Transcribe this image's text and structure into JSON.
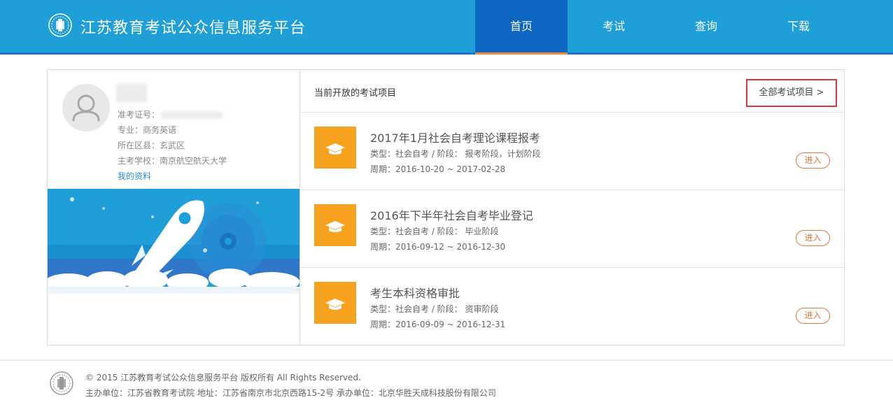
{
  "header": {
    "site_title": "江苏教育考试公众信息服务平台",
    "nav": [
      {
        "label": "首页",
        "active": true
      },
      {
        "label": "考试",
        "active": false
      },
      {
        "label": "查询",
        "active": false
      },
      {
        "label": "下载",
        "active": false
      }
    ]
  },
  "profile": {
    "id_label": "准考证号：",
    "major": "专业：商务英语",
    "district": "所在区县：玄武区",
    "school": "主考学校：南京航空航天大学",
    "my_profile_link": "我的资料"
  },
  "exams_panel": {
    "title": "当前开放的考试项目",
    "all_link": "全部考试项目 >",
    "items": [
      {
        "title": "2017年1月社会自考理论课程报考",
        "type_line": "类型：社会自考 / 阶段： 报考阶段，计划阶段",
        "period_line": "周期：2016-10-20 ~ 2017-02-28",
        "enter": "进入"
      },
      {
        "title": "2016年下半年社会自考毕业登记",
        "type_line": "类型：社会自考 / 阶段： 毕业阶段",
        "period_line": "周期：2016-09-12 ~ 2016-12-30",
        "enter": "进入"
      },
      {
        "title": "考生本科资格审批",
        "type_line": "类型：社会自考 / 阶段： 资审阶段",
        "period_line": "周期：2016-09-09 ~ 2016-12-31",
        "enter": "进入"
      }
    ]
  },
  "footer": {
    "copyright": "© 2015 江苏教育考试公众信息服务平台 版权所有 All Rights Reserved.",
    "organizer": "主办单位：江苏省教育考试院 地址：江苏省南京市北京西路15-2号 承办单位：北京华胜天成科技股份有限公司"
  },
  "colors": {
    "header_bg": "#1e9fd7",
    "nav_active_bg": "#0d66c2",
    "accent_orange": "#f7a21e",
    "enter_button": "#e6763a",
    "highlight_box": "#d9363e"
  },
  "icons": [
    "emblem-logo-icon",
    "avatar-user-icon",
    "rocket-banner-illustration",
    "graduation-cap-icon"
  ]
}
